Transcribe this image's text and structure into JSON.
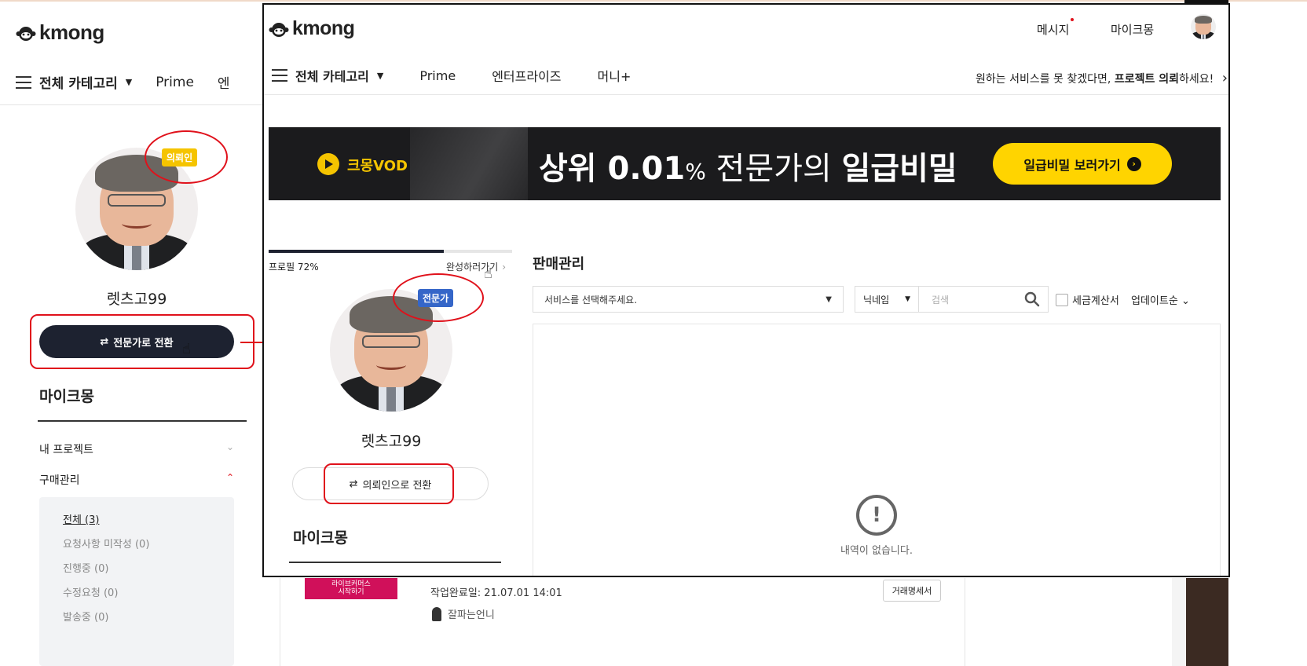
{
  "colors": {
    "brand_dark": "#1d2230",
    "annotation_red": "#e0111b",
    "badge_client": "#f5c400",
    "badge_expert": "#3566c8",
    "banner_yellow": "#ffd400"
  },
  "background_page": {
    "logo": "kmong",
    "nav": {
      "category": "전체 카테고리",
      "prime": "Prime",
      "partial_item": "엔"
    },
    "profile": {
      "badge": "의뢰인",
      "username": "렛츠고99",
      "switch_button": "전문가로 전환"
    },
    "my_kmong_title": "마이크몽",
    "menu": {
      "my_projects": "내 프로젝트",
      "purchase_management": "구매관리"
    },
    "purchase_submenu": [
      {
        "label": "전체 (3)",
        "active": true
      },
      {
        "label": "요청사항 미작성 (0)",
        "active": false
      },
      {
        "label": "진행중 (0)",
        "active": false
      },
      {
        "label": "수정요청 (0)",
        "active": false
      },
      {
        "label": "발송중 (0)",
        "active": false
      }
    ],
    "order_card": {
      "thumb_line1": "라이브커머스",
      "thumb_line2": "시작하기",
      "completed": "작업완료일: 21.07.01 14:01",
      "seller": "잘파는언니",
      "invoice_button": "거래명세서"
    }
  },
  "popup": {
    "logo": "kmong",
    "header": {
      "messages": "메시지",
      "my_kmong": "마이크몽"
    },
    "nav": {
      "category": "전체 카테고리",
      "items": [
        "Prime",
        "엔터프라이즈",
        "머니+"
      ]
    },
    "cta": {
      "prefix": "원하는 서비스를 못 찾겠다면, ",
      "bold": "프로젝트 의뢰",
      "suffix": "하세요!",
      "arrow": "›"
    },
    "banner": {
      "vod": "크몽VOD",
      "headline_bold1": "상위 0.01",
      "headline_pct": "%",
      "headline_light": " 전문가의 ",
      "headline_bold2": "일급비밀",
      "button": "일급비밀 보러가기",
      "button_arrow": "›"
    },
    "profile": {
      "completion_label": "프로필 72%",
      "completion_value": 0.72,
      "complete_link": "완성하러가기",
      "complete_arrow": "›",
      "badge": "전문가",
      "username": "렛츠고99",
      "switch_button": "의뢰인으로 전환"
    },
    "my_kmong_title": "마이크몽",
    "sales": {
      "title": "판매관리",
      "service_select_placeholder": "서비스를 선택해주세요.",
      "nickname_select": "닉네임",
      "search_placeholder": "검색",
      "tax_invoice": "세금계산서",
      "sort": "업데이트순",
      "sort_arrow": "⌄",
      "empty_message": "내역이 없습니다."
    }
  }
}
